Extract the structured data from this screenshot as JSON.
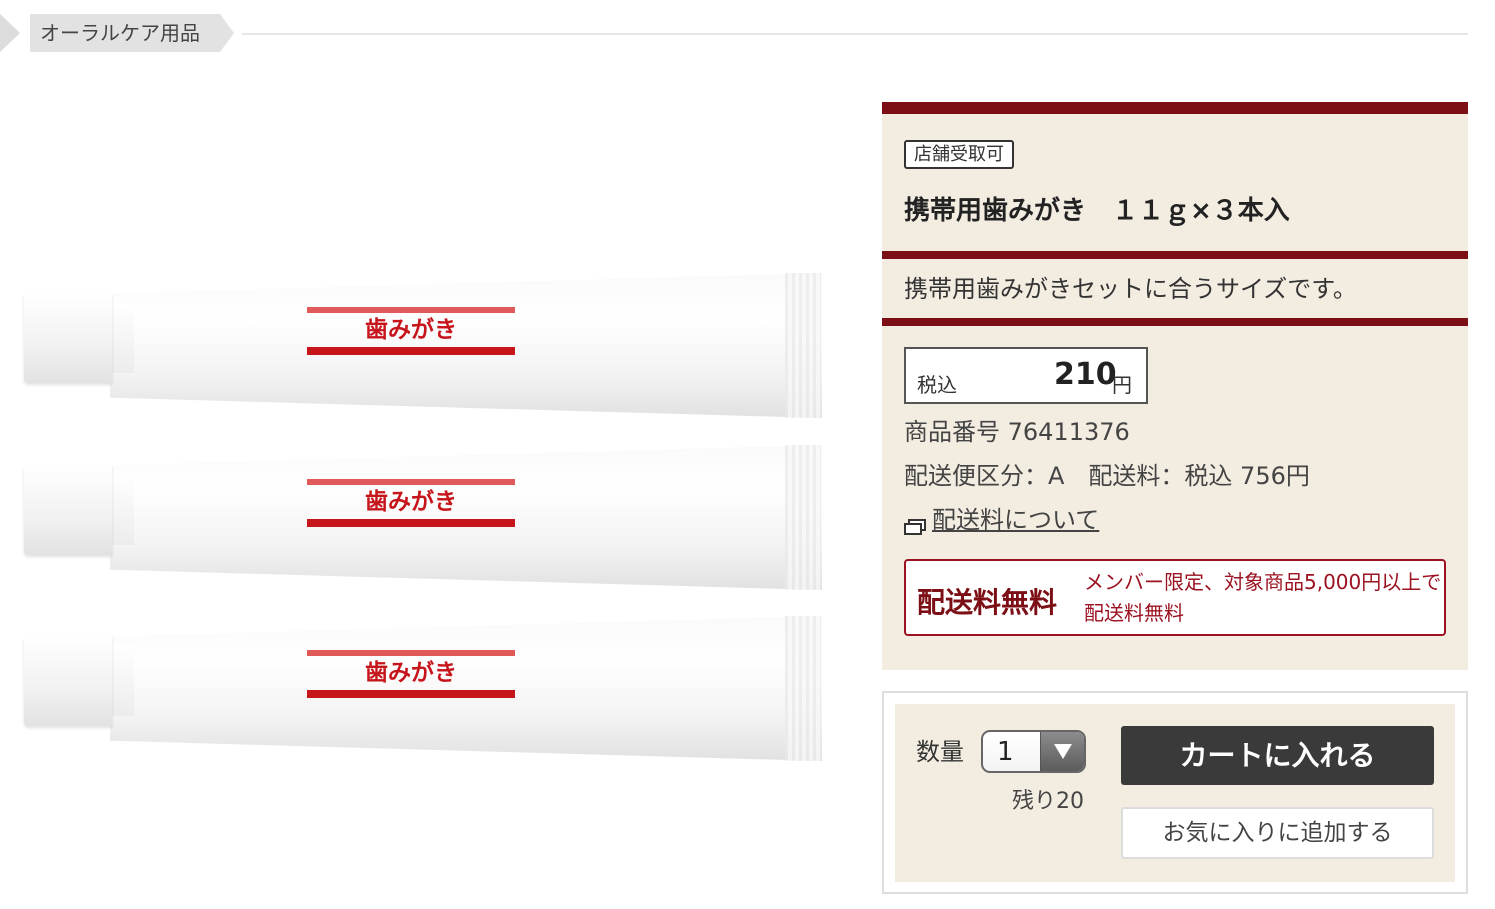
{
  "breadcrumb": {
    "label": "オーラルケア用品"
  },
  "product_image": {
    "tube_label": "歯みがき",
    "tube_count": 3
  },
  "product": {
    "badge": "店舗受取可",
    "title": "携帯用歯みがき　１１ｇ×３本入",
    "description": "携帯用歯みがきセットに合うサイズです。",
    "price_label": "税込",
    "price": "210",
    "price_unit": "円",
    "item_number": "商品番号 76411376",
    "shipping_info": "配送便区分：A　配送料：税込 756円",
    "shipping_link": "配送料について",
    "free_shipping_title": "配送料無料",
    "free_shipping_text": "メンバー限定、対象商品5,000円以上で配送料無料"
  },
  "cart": {
    "qty_label": "数量",
    "qty_value": "1",
    "stock": "残り20",
    "add_to_cart": "カートに入れる",
    "add_favorite": "お気に入りに追加する"
  },
  "colors": {
    "accent": "#7c0f16",
    "panel": "#f3ede1",
    "tube_red": "#c6161c"
  }
}
